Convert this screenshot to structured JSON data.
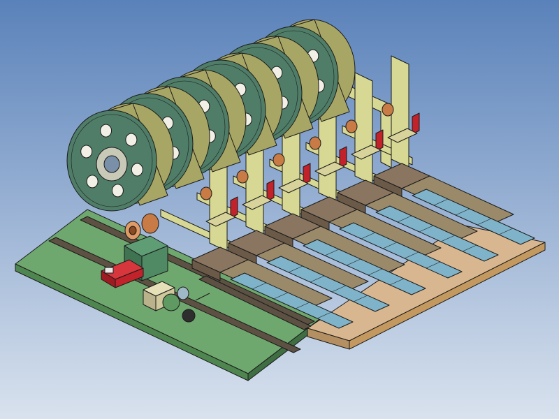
{
  "scene": {
    "view": "isometric-cad-assembly",
    "units": 6,
    "colors": {
      "background_top": "#5a82ba",
      "background_bottom": "#d9e2ee",
      "base_plate": "#6fa86f",
      "wood_board": "#d8b790",
      "frame": "#d6d893",
      "reel_face": "#4f7d68",
      "reel_rim": "#a8a665",
      "rail": "#5c5142",
      "strip": "#7fb3c9",
      "guide_block": "#6b5a48",
      "accent_red": "#c2232a",
      "copper": "#c97b45",
      "motor": "#4f8a64"
    },
    "icons": [
      "reel-hub-icon",
      "red-clamp-icon",
      "valve-icon",
      "motor-icon"
    ]
  }
}
